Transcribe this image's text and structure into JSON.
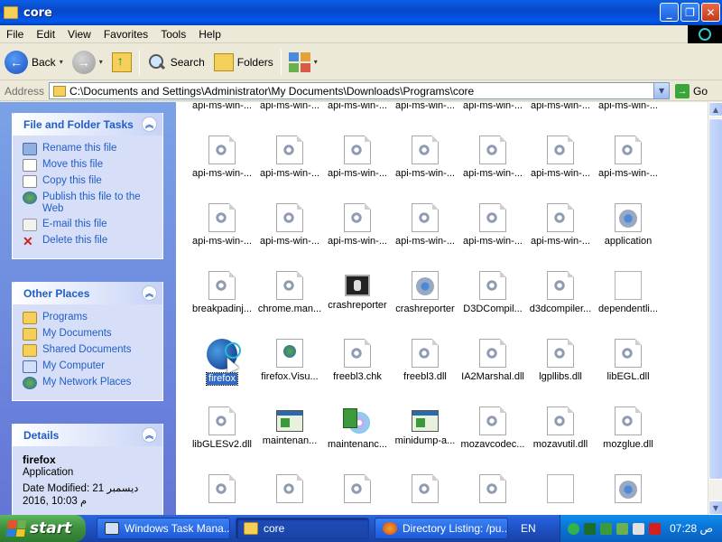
{
  "window": {
    "title": "core",
    "minimize_label": "_",
    "maximize_label": "❐",
    "close_label": "✕"
  },
  "menu": [
    "File",
    "Edit",
    "View",
    "Favorites",
    "Tools",
    "Help"
  ],
  "toolbar": {
    "back_label": "Back",
    "search_label": "Search",
    "folders_label": "Folders",
    "dropdown_glyph": "▾"
  },
  "address": {
    "label": "Address",
    "path": "C:\\Documents and Settings\\Administrator\\My Documents\\Downloads\\Programs\\core",
    "go_label": "Go"
  },
  "tasks_panel": {
    "title": "File and Folder Tasks",
    "items": [
      "Rename this file",
      "Move this file",
      "Copy this file",
      "Publish this file to the Web",
      "E-mail this file",
      "Delete this file"
    ]
  },
  "places_panel": {
    "title": "Other Places",
    "items": [
      "Programs",
      "My Documents",
      "Shared Documents",
      "My Computer",
      "My Network Places"
    ]
  },
  "details_panel": {
    "title": "Details",
    "name": "firefox",
    "type": "Application",
    "modified_line1": "Date Modified: 21 ديسمبر",
    "modified_line2": "2016, 10:03 م"
  },
  "files": [
    {
      "name": "api-ms-win-...",
      "icon": "dll-gear-icon"
    },
    {
      "name": "api-ms-win-...",
      "icon": "dll-gear-icon"
    },
    {
      "name": "api-ms-win-...",
      "icon": "dll-gear-icon"
    },
    {
      "name": "api-ms-win-...",
      "icon": "dll-gear-icon"
    },
    {
      "name": "api-ms-win-...",
      "icon": "dll-gear-icon"
    },
    {
      "name": "api-ms-win-...",
      "icon": "dll-gear-icon"
    },
    {
      "name": "api-ms-win-...",
      "icon": "dll-gear-icon"
    },
    {
      "name": "api-ms-win-...",
      "icon": "dll-gear-icon"
    },
    {
      "name": "api-ms-win-...",
      "icon": "dll-gear-icon"
    },
    {
      "name": "api-ms-win-...",
      "icon": "dll-gear-icon"
    },
    {
      "name": "api-ms-win-...",
      "icon": "dll-gear-icon"
    },
    {
      "name": "api-ms-win-...",
      "icon": "dll-gear-icon"
    },
    {
      "name": "api-ms-win-...",
      "icon": "dll-gear-icon"
    },
    {
      "name": "api-ms-win-...",
      "icon": "dll-gear-icon"
    },
    {
      "name": "api-ms-win-...",
      "icon": "dll-gear-icon"
    },
    {
      "name": "api-ms-win-...",
      "icon": "dll-gear-icon"
    },
    {
      "name": "api-ms-win-...",
      "icon": "dll-gear-icon"
    },
    {
      "name": "api-ms-win-...",
      "icon": "dll-gear-icon"
    },
    {
      "name": "api-ms-win-...",
      "icon": "dll-gear-icon"
    },
    {
      "name": "api-ms-win-...",
      "icon": "dll-gear-icon"
    },
    {
      "name": "application",
      "icon": "config-gear-icon"
    },
    {
      "name": "breakpadinj...",
      "icon": "dll-gear-icon"
    },
    {
      "name": "chrome.man...",
      "icon": "dll-gear-icon"
    },
    {
      "name": "crashreporter",
      "icon": "crashreporter-app-icon"
    },
    {
      "name": "crashreporter",
      "icon": "config-gear-icon"
    },
    {
      "name": "D3DCompil...",
      "icon": "dll-gear-icon"
    },
    {
      "name": "d3dcompiler...",
      "icon": "dll-gear-icon"
    },
    {
      "name": "dependentli...",
      "icon": "blank-file-icon"
    },
    {
      "name": "firefox",
      "icon": "firefox-icon"
    },
    {
      "name": "firefox.Visu...",
      "icon": "web-manifest-icon"
    },
    {
      "name": "freebl3.chk",
      "icon": "dll-gear-icon"
    },
    {
      "name": "freebl3.dll",
      "icon": "dll-gear-icon"
    },
    {
      "name": "IA2Marshal.dll",
      "icon": "dll-gear-icon"
    },
    {
      "name": "lgpllibs.dll",
      "icon": "dll-gear-icon"
    },
    {
      "name": "libEGL.dll",
      "icon": "dll-gear-icon"
    },
    {
      "name": "libGLESv2.dll",
      "icon": "dll-gear-icon"
    },
    {
      "name": "maintenan...",
      "icon": "window-app-icon"
    },
    {
      "name": "maintenanc...",
      "icon": "installer-disc-icon"
    },
    {
      "name": "minidump-a...",
      "icon": "window-app-icon"
    },
    {
      "name": "mozavcodec...",
      "icon": "dll-gear-icon"
    },
    {
      "name": "mozavutil.dll",
      "icon": "dll-gear-icon"
    },
    {
      "name": "mozglue.dll",
      "icon": "dll-gear-icon"
    }
  ],
  "taskbar": {
    "start_label": "start",
    "tasks": [
      "Windows Task Mana...",
      "core",
      "Directory Listing: /pu..."
    ],
    "language": "EN",
    "clock": "07:28 ص"
  }
}
